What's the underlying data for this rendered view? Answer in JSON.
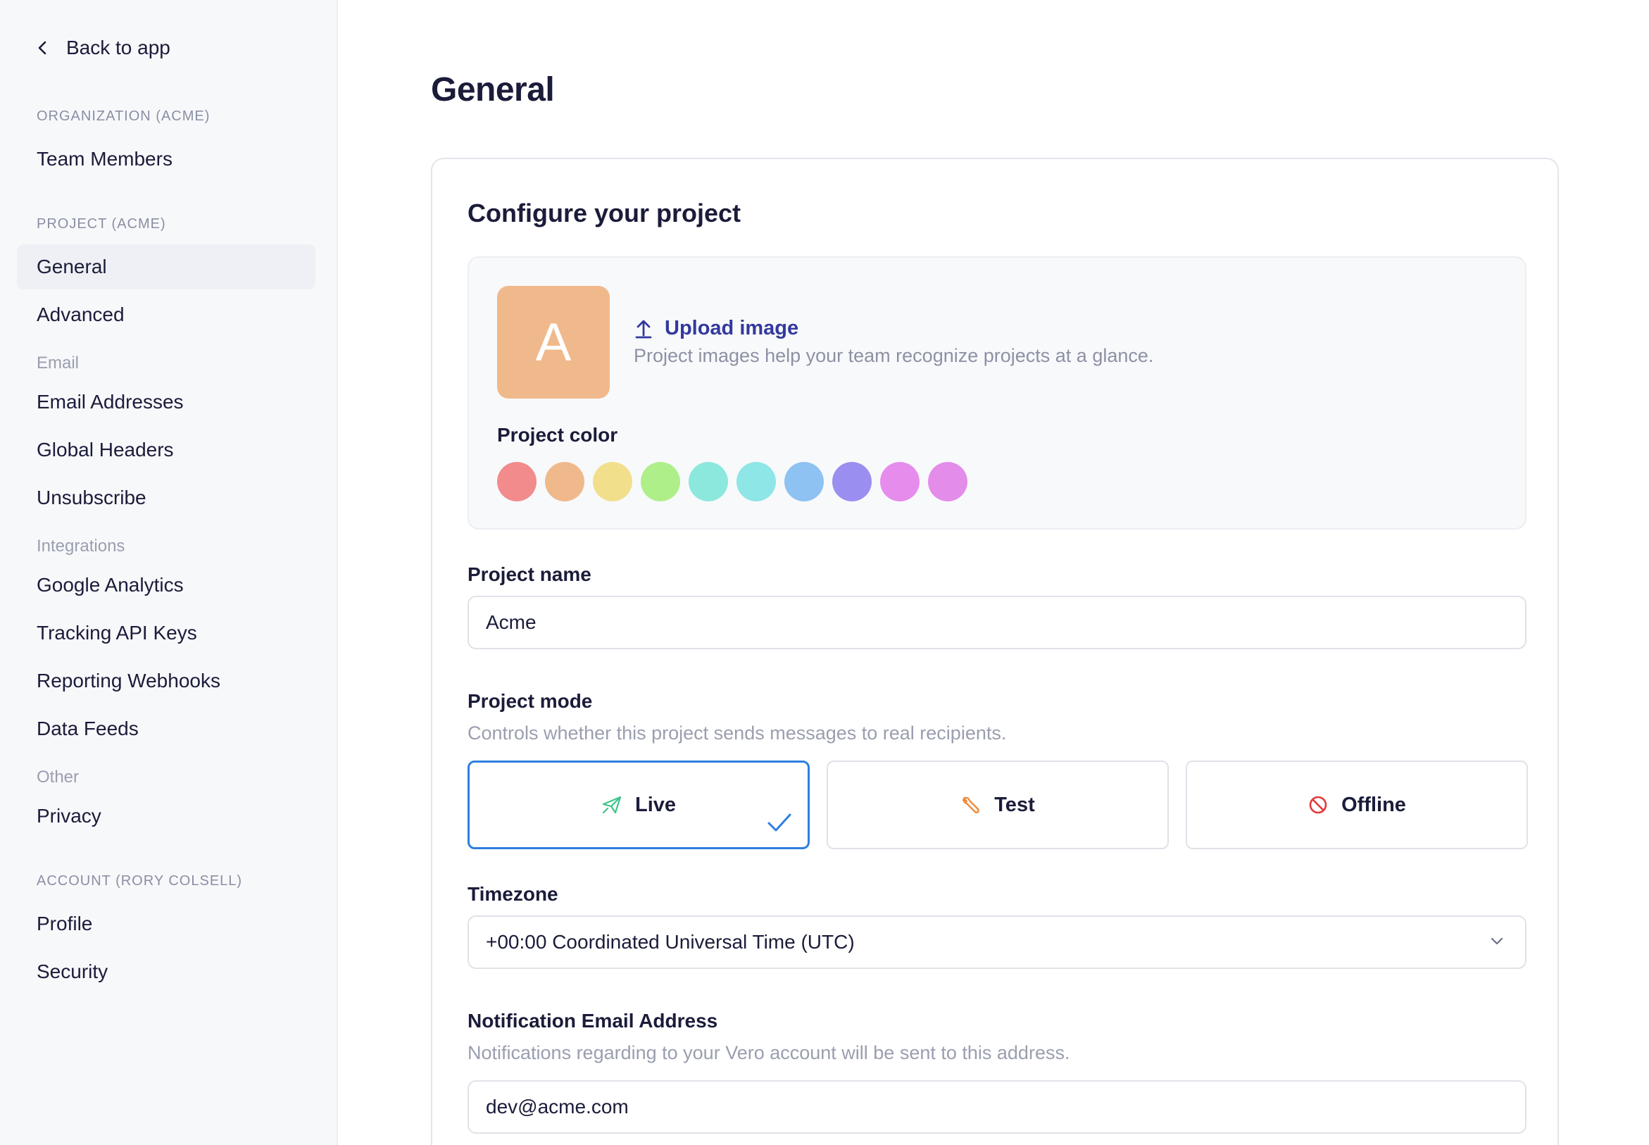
{
  "sidebar": {
    "back_label": "Back to app",
    "org_heading": "ORGANIZATION (ACME)",
    "org_items": [
      {
        "label": "Team Members"
      }
    ],
    "project_heading": "PROJECT (ACME)",
    "project_items": [
      {
        "label": "General",
        "active": true
      },
      {
        "label": "Advanced"
      }
    ],
    "email_heading": "Email",
    "email_items": [
      {
        "label": "Email Addresses"
      },
      {
        "label": "Global Headers"
      },
      {
        "label": "Unsubscribe"
      }
    ],
    "integrations_heading": "Integrations",
    "integration_items": [
      {
        "label": "Google Analytics"
      },
      {
        "label": "Tracking API Keys"
      },
      {
        "label": "Reporting Webhooks"
      },
      {
        "label": "Data Feeds"
      }
    ],
    "other_heading": "Other",
    "other_items": [
      {
        "label": "Privacy"
      }
    ],
    "account_heading": "ACCOUNT (RORY COLSELL)",
    "account_items": [
      {
        "label": "Profile"
      },
      {
        "label": "Security"
      }
    ]
  },
  "main": {
    "title": "General",
    "card_title": "Configure your project",
    "avatar_letter": "A",
    "avatar_color": "#f0b98c",
    "upload_label": "Upload image",
    "upload_help": "Project images help your team recognize projects at a glance.",
    "color_label": "Project color",
    "colors": [
      "#f28b8b",
      "#f0b98c",
      "#f2df8c",
      "#aeef8a",
      "#8ce8dd",
      "#8ee6e6",
      "#8dc2f2",
      "#9a8ef0",
      "#e68cec",
      "#e38cea"
    ],
    "project_name_label": "Project name",
    "project_name_value": "Acme",
    "mode_label": "Project mode",
    "mode_help": "Controls whether this project sends messages to real recipients.",
    "modes": [
      {
        "label": "Live",
        "icon": "paper-plane-icon",
        "selected": true
      },
      {
        "label": "Test",
        "icon": "wrench-icon"
      },
      {
        "label": "Offline",
        "icon": "prohibited-icon"
      }
    ],
    "timezone_label": "Timezone",
    "timezone_value": "+00:00 Coordinated Universal Time (UTC)",
    "notification_label": "Notification Email Address",
    "notification_help": "Notifications regarding to your Vero account will be sent to this address.",
    "notification_value": "dev@acme.com"
  }
}
